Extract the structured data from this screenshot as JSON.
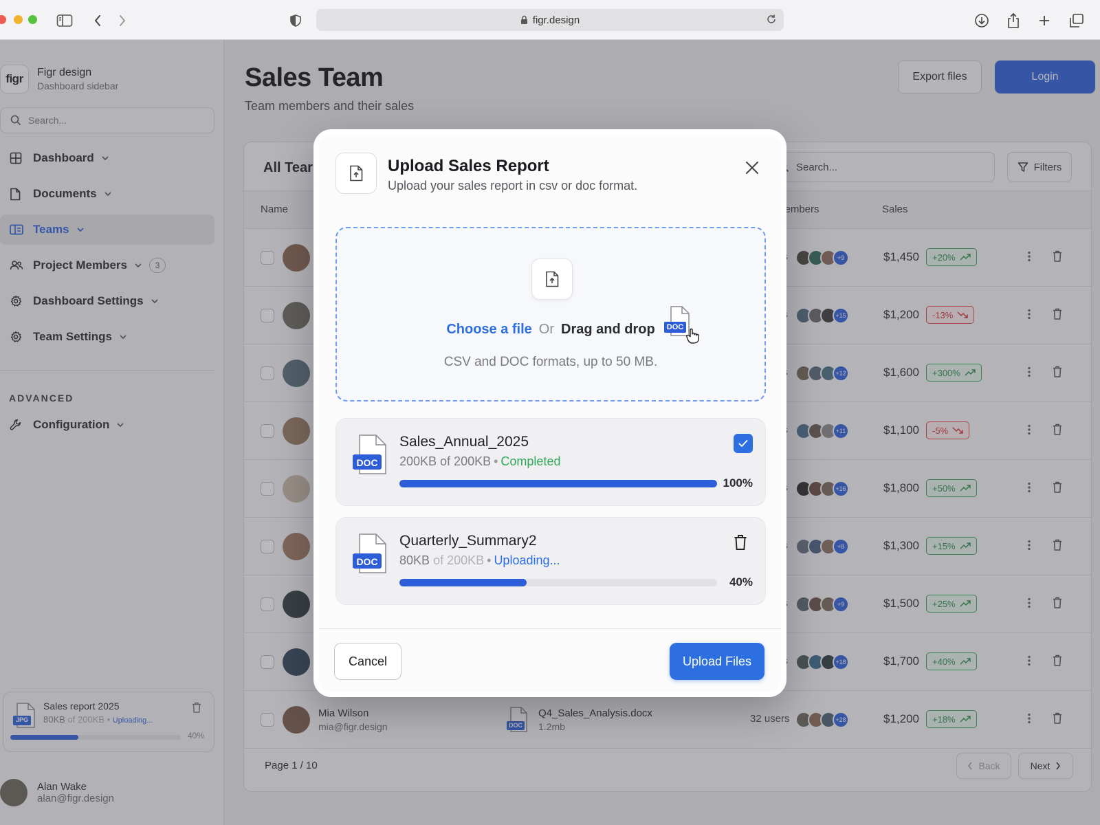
{
  "browser": {
    "url": "figr.design"
  },
  "sidebar": {
    "brand_logo": "figr",
    "brand_name": "Figr design",
    "brand_sub": "Dashboard sidebar",
    "search_placeholder": "Search...",
    "items": [
      {
        "label": "Dashboard",
        "icon": "grid-icon"
      },
      {
        "label": "Documents",
        "icon": "document-icon"
      },
      {
        "label": "Teams",
        "icon": "teams-icon",
        "active": true
      },
      {
        "label": "Project Members",
        "icon": "users-icon",
        "badge": "3"
      },
      {
        "label": "Dashboard Settings",
        "icon": "gear-icon"
      },
      {
        "label": "Team Settings",
        "icon": "gear-icon"
      }
    ],
    "section_label": "ADVANCED",
    "advanced_items": [
      {
        "label": "Configuration",
        "icon": "wrench-icon"
      }
    ],
    "upload": {
      "file_type": "JPG",
      "title": "Sales report 2025",
      "size_done": "80KB",
      "size_total": "of 200KB",
      "sep": "•",
      "status": "Uploading...",
      "progress_label": "40%",
      "progress": 0.4
    },
    "user": {
      "name": "Alan Wake",
      "email": "alan@figr.design"
    }
  },
  "header": {
    "title": "Sales Team",
    "subtitle": "Team members and their sales",
    "export_label": "Export files",
    "login_label": "Login"
  },
  "table": {
    "title": "All Tear",
    "search_placeholder": "Search...",
    "filters_label": "Filters",
    "columns": {
      "name": "Name",
      "members": "Members",
      "sales": "Sales"
    },
    "rows": [
      {
        "users_suffix": "ers",
        "more": "+9",
        "sales": "$1,450",
        "trend": "+20%",
        "dir": "up"
      },
      {
        "users_suffix": "ers",
        "more": "+15",
        "sales": "$1,200",
        "trend": "-13%",
        "dir": "down"
      },
      {
        "users_suffix": "ers",
        "more": "+12",
        "sales": "$1,600",
        "trend": "+300%",
        "dir": "up"
      },
      {
        "users_suffix": "ers",
        "more": "+11",
        "sales": "$1,100",
        "trend": "-5%",
        "dir": "down"
      },
      {
        "users_suffix": "ers",
        "more": "+16",
        "sales": "$1,800",
        "trend": "+50%",
        "dir": "up"
      },
      {
        "users_suffix": "ers",
        "more": "+8",
        "sales": "$1,300",
        "trend": "+15%",
        "dir": "up"
      },
      {
        "users_suffix": "ers",
        "more": "+9",
        "sales": "$1,500",
        "trend": "+25%",
        "dir": "up"
      },
      {
        "users_suffix": "ers",
        "more": "+18",
        "sales": "$1,700",
        "trend": "+40%",
        "dir": "up"
      }
    ],
    "last_row": {
      "name": "Mia Wilson",
      "email": "mia@figr.design",
      "doc_type": "DOC",
      "doc_name": "Q4_Sales_Analysis.docx",
      "doc_size": "1.2mb",
      "users": "32 users",
      "more": "+28",
      "sales": "$1,200",
      "trend": "+18%",
      "dir": "up"
    },
    "page_label": "Page 1 / 10",
    "back_label": "Back",
    "next_label": "Next"
  },
  "modal": {
    "title": "Upload Sales Report",
    "subtitle": "Upload your sales report in csv or doc format.",
    "choose_label": "Choose a file",
    "or_label": "Or",
    "drag_label": "Drag and drop",
    "doc_badge": "DOC",
    "hint": "CSV and DOC  formats, up to 50 MB.",
    "files": [
      {
        "badge": "DOC",
        "name": "Sales_Annual_2025",
        "size_done": "200KB of 200KB",
        "sep": "•",
        "status": "Completed",
        "progress_label": "100%",
        "progress": 1.0
      },
      {
        "badge": "DOC",
        "name": "Quarterly_Summary2",
        "size_done": "80KB",
        "size_total": "of 200KB",
        "sep": "•",
        "status": "Uploading...",
        "progress_label": "40%",
        "progress": 0.4
      }
    ],
    "cancel_label": "Cancel",
    "upload_label": "Upload Files"
  },
  "colors": {
    "accent": "#2d5ed8",
    "success": "#2fa85a",
    "danger": "#d13338"
  }
}
